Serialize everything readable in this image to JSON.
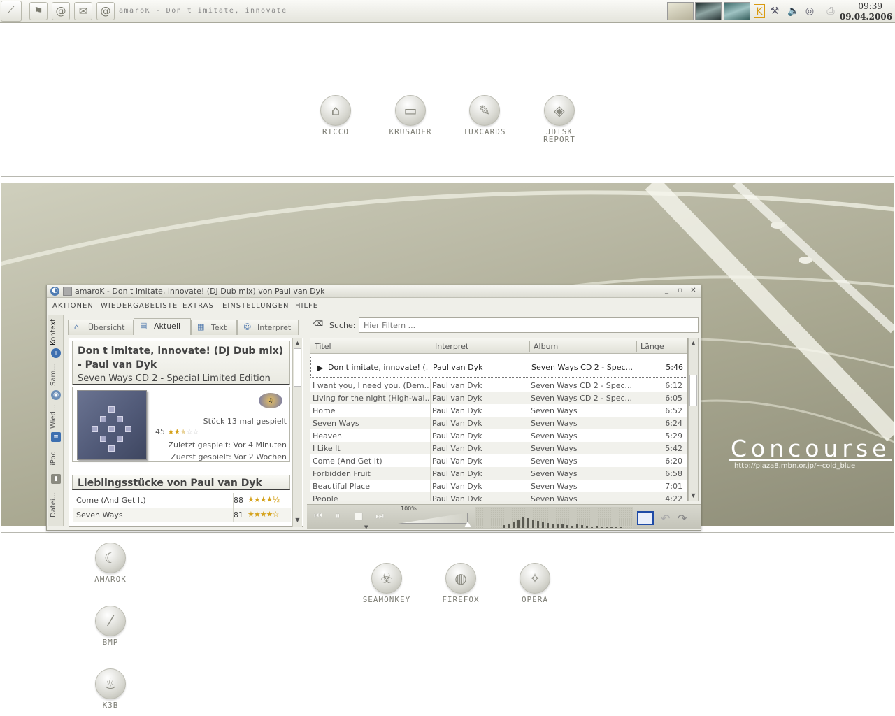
{
  "panel": {
    "taskbar_title": "amaroK - Don t imitate, innovate",
    "clock_time": "09:39",
    "clock_date": "09.04.2006",
    "launchers": [
      "kmenu-icon",
      "kde-icon",
      "at-icon",
      "mail-icon",
      "at-icon"
    ]
  },
  "desktop_top": [
    {
      "label": "RICCO",
      "icon": "home-icon"
    },
    {
      "label": "KRUSADER",
      "icon": "folder-icon"
    },
    {
      "label": "TUXCARDS",
      "icon": "notes-icon"
    },
    {
      "label": "JDISK REPORT",
      "icon": "disk-icon"
    }
  ],
  "desktop_left": [
    {
      "label": "AMAROK",
      "icon": "wolf-icon"
    },
    {
      "label": "BMP",
      "icon": "bmp-icon"
    },
    {
      "label": "K3B",
      "icon": "flame-icon"
    }
  ],
  "desktop_middle": [
    {
      "label": "SEAMONKEY",
      "icon": "seamonkey-icon"
    },
    {
      "label": "FIREFOX",
      "icon": "firefox-icon"
    },
    {
      "label": "OPERA",
      "icon": "compass-icon"
    }
  ],
  "wallpaper": {
    "title": "Concourse",
    "url": "http://plaza8.mbn.or.jp/~cold_blue"
  },
  "amarok": {
    "title": "amaroK - Don t imitate, innovate! (DJ Dub mix) von Paul van Dyk",
    "menu": [
      "Aktionen",
      "Wiedergabeliste",
      "Extras",
      "Einstellungen",
      "Hilfe"
    ],
    "side_tabs": [
      "Kontext",
      "Sam...",
      "Wied...",
      "iPod",
      "Datei..."
    ],
    "context_tabs": [
      "Übersicht",
      "Aktuell",
      "Text",
      "Interpret"
    ],
    "now_playing": {
      "track": "Don t imitate, innovate! (DJ Dub mix) - Paul van Dyk",
      "album": "Seven Ways CD 2 - Special Limited Edition",
      "play_count": "Stück 13 mal gespielt",
      "score": "45",
      "rating_stars": 2.5,
      "last_played": "Zuletzt gespielt: Vor 4 Minuten",
      "first_played": "Zuerst gespielt: Vor 2 Wochen"
    },
    "favorites": {
      "heading": "Lieblingsstücke von Paul van Dyk",
      "items": [
        {
          "title": "Come (And Get It)",
          "score": "88",
          "stars": "★★★★½"
        },
        {
          "title": "Seven Ways",
          "score": "81",
          "stars": "★★★★☆"
        }
      ]
    },
    "search": {
      "label": "Suche:",
      "placeholder": "Hier Filtern ..."
    },
    "playlist": {
      "columns": [
        "Titel",
        "Interpret",
        "Album",
        "Länge"
      ],
      "current": {
        "title": "Don t imitate, innovate! (...",
        "artist": "Paul van Dyk",
        "album": "Seven Ways CD 2 - Spec...",
        "length": "5:46"
      },
      "rows": [
        {
          "title": "I want you, I need you. (Dem...",
          "artist": "Paul van Dyk",
          "album": "Seven Ways CD 2 - Spec...",
          "length": "6:12"
        },
        {
          "title": "Living for the night (High-wai...",
          "artist": "Paul van Dyk",
          "album": "Seven Ways CD 2 - Spec...",
          "length": "6:05"
        },
        {
          "title": "Home",
          "artist": "Paul Van Dyk",
          "album": "Seven Ways",
          "length": "6:52"
        },
        {
          "title": "Seven Ways",
          "artist": "Paul Van Dyk",
          "album": "Seven Ways",
          "length": "6:24"
        },
        {
          "title": "Heaven",
          "artist": "Paul Van Dyk",
          "album": "Seven Ways",
          "length": "5:29"
        },
        {
          "title": "I Like It",
          "artist": "Paul Van Dyk",
          "album": "Seven Ways",
          "length": "5:42"
        },
        {
          "title": "Come (And Get It)",
          "artist": "Paul Van Dyk",
          "album": "Seven Ways",
          "length": "6:20"
        },
        {
          "title": "Forbidden Fruit",
          "artist": "Paul Van Dyk",
          "album": "Seven Ways",
          "length": "6:58"
        },
        {
          "title": "Beautiful Place",
          "artist": "Paul Van Dyk",
          "album": "Seven Ways",
          "length": "7:01"
        },
        {
          "title": "People",
          "artist": "Paul Van Dyk",
          "album": "Seven Ways",
          "length": "4:22"
        }
      ]
    },
    "player": {
      "volume_label": "100%",
      "volume": 1.0
    }
  }
}
